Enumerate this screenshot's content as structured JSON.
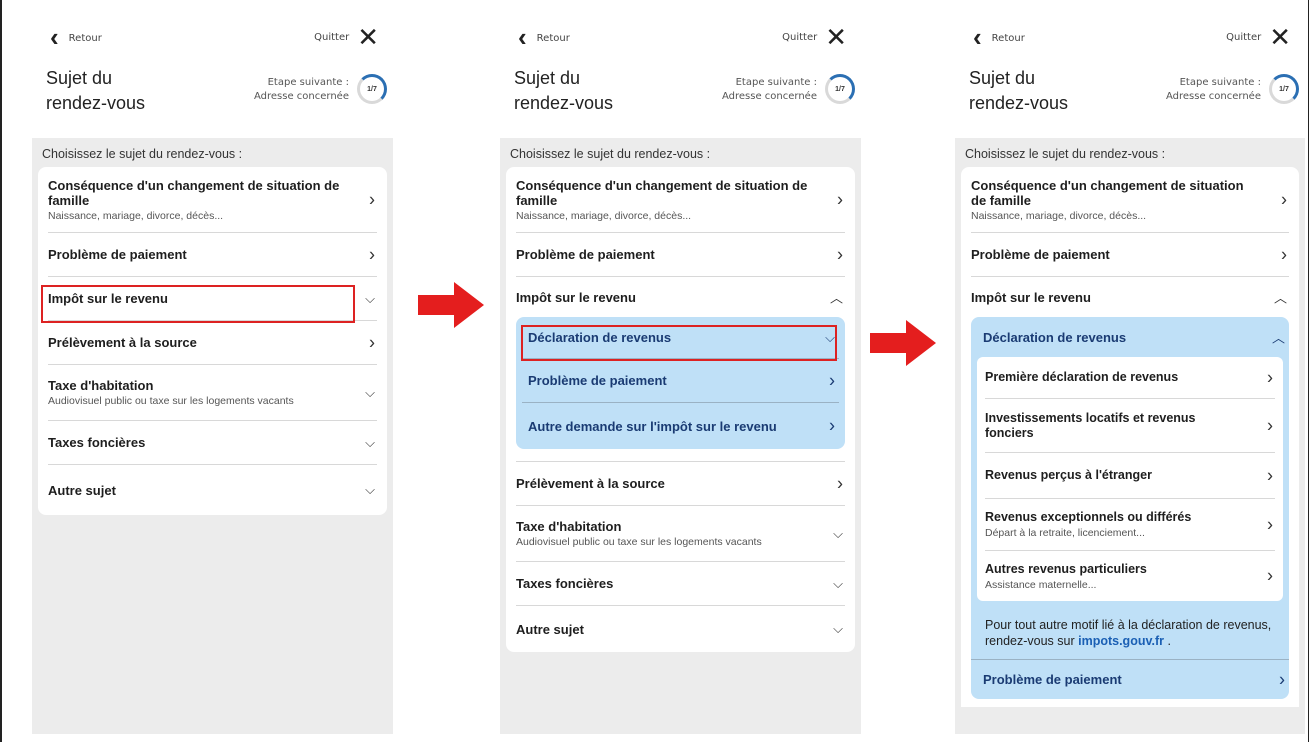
{
  "common": {
    "back_label": "Retour",
    "quit_label": "Quitter",
    "title_line1": "Sujet du",
    "title_line2": "rendez-vous",
    "next_label": "Etape suivante :",
    "next_value": "Adresse concernée",
    "progress": "1/7",
    "instruction": "Choisissez le sujet du rendez-vous :"
  },
  "subjects": {
    "famille_title": "Conséquence d'un changement de situation de famille",
    "famille_sub": "Naissance, mariage, divorce, décès...",
    "paiement": "Problème de paiement",
    "impot": "Impôt sur le revenu",
    "prelevement": "Prélèvement à la source",
    "habitation_title": "Taxe d'habitation",
    "habitation_sub": "Audiovisuel public ou taxe sur les logements vacants",
    "foncieres": "Taxes foncières",
    "autre": "Autre sujet"
  },
  "impot_sub": {
    "declaration": "Déclaration de revenus",
    "paiement": "Problème de paiement",
    "autre_demande": "Autre demande sur l'impôt sur le revenu"
  },
  "declaration_sub": {
    "premiere": "Première déclaration de revenus",
    "investissements": "Investissements locatifs et revenus fonciers",
    "etranger": "Revenus perçus à l'étranger",
    "exceptionnels_title": "Revenus exceptionnels ou différés",
    "exceptionnels_sub": "Départ à la retraite, licenciement...",
    "particuliers_title": "Autres revenus particuliers",
    "particuliers_sub": "Assistance maternelle...",
    "note_text": "Pour tout autre motif lié à la déclaration de revenus, rendez-vous sur",
    "note_link": "impots.gouv.fr",
    "note_end": "."
  },
  "icons": {
    "chevron_right": "chevron-right-icon",
    "chevron_down": "chevron-down-icon",
    "chevron_up": "chevron-up-icon"
  },
  "colors": {
    "highlight": "#dd2222",
    "arrow": "#e41e1e",
    "submenu_bg": "#bfe0f7",
    "submenu_text": "#1a3b73",
    "link": "#1a5fb4"
  }
}
